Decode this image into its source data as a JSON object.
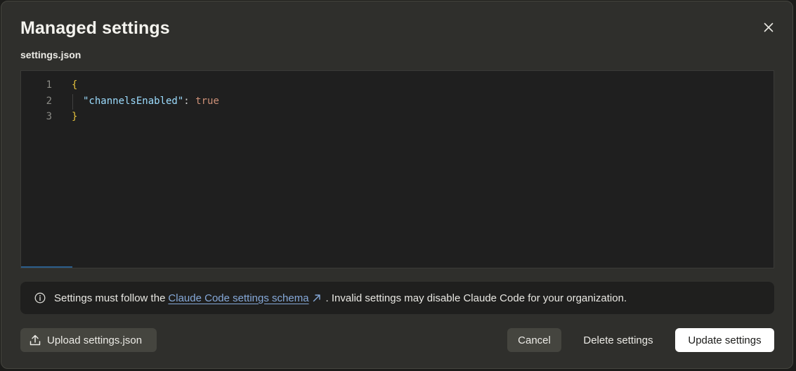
{
  "dialog": {
    "title": "Managed settings",
    "filename": "settings.json"
  },
  "editor": {
    "lines": [
      {
        "number": "1",
        "text": "{"
      },
      {
        "number": "2",
        "key": "\"channelsEnabled\"",
        "colon": ": ",
        "value": "true"
      },
      {
        "number": "3",
        "text": "}"
      }
    ]
  },
  "info": {
    "prefix": "Settings must follow the",
    "link_text": "Claude Code settings schema",
    "suffix": ". Invalid settings may disable Claude Code for your organization."
  },
  "buttons": {
    "upload": "Upload settings.json",
    "cancel": "Cancel",
    "delete": "Delete settings",
    "update": "Update settings"
  },
  "icons": {
    "close": "close-icon",
    "info": "info-icon",
    "external_link": "arrow-up-right-icon",
    "upload": "upload-icon"
  },
  "colors": {
    "dialog_bg": "#2f2f2c",
    "editor_bg": "#1f1f1f",
    "brace": "#e5c23d",
    "json_key": "#9cdcfe",
    "json_bool": "#ce9178",
    "link": "#86a9d9",
    "primary_button_bg": "#ffffff"
  }
}
